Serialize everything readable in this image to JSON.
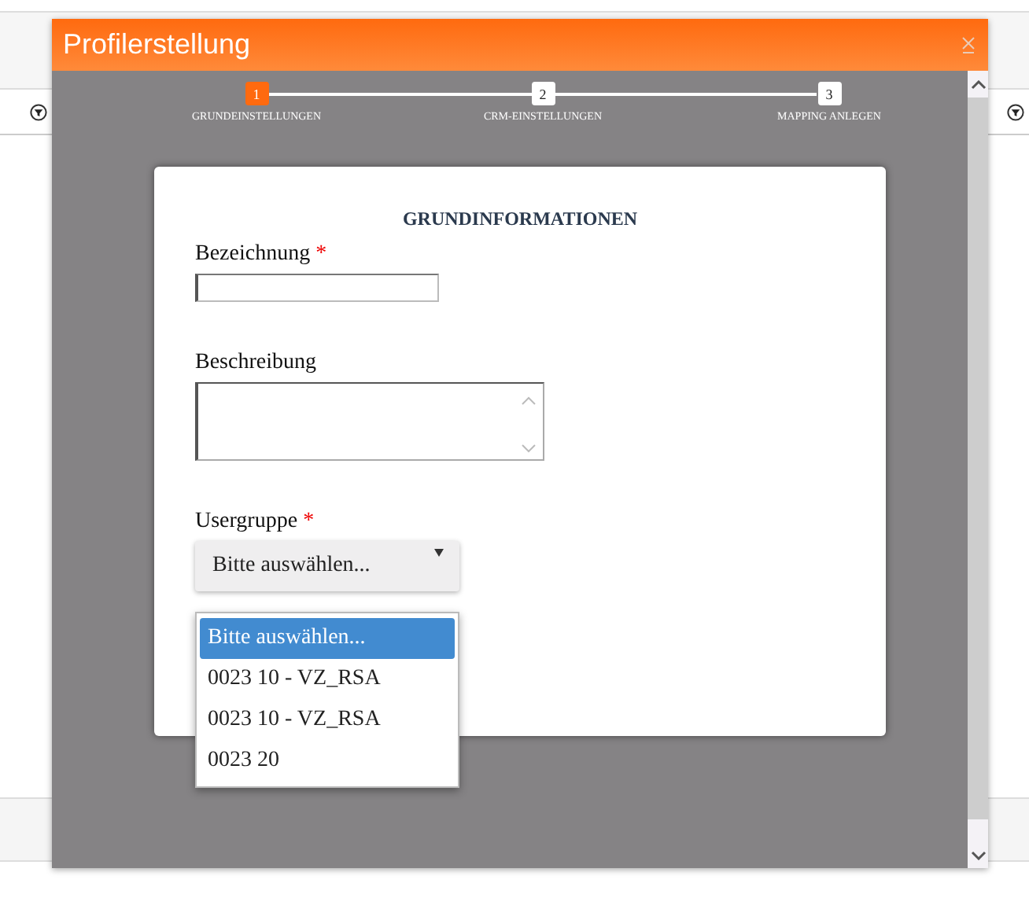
{
  "dialog": {
    "title": "Profilerstellung",
    "steps": [
      {
        "number": "1",
        "label": "GRUNDEINSTELLUNGEN",
        "selected": true
      },
      {
        "number": "2",
        "label": "CRM-EINSTELLUNGEN",
        "selected": false
      },
      {
        "number": "3",
        "label": "MAPPING ANLEGEN",
        "selected": false
      }
    ],
    "section_title": "GRUNDINFORMATIONEN",
    "fields": [
      {
        "kind": "text",
        "label": "Bezeichnung",
        "required_mark": "*"
      },
      {
        "kind": "textarea",
        "label": "Beschreibung"
      },
      {
        "kind": "select",
        "label": "Usergruppe",
        "required_mark": "*",
        "value": "Bitte auswählen...",
        "expanded": true,
        "options": [
          {
            "label": "Bitte auswählen...",
            "selected": true
          },
          {
            "label": "0023 10 - VZ_RSA",
            "selected": false
          },
          {
            "label": "0023 10 - VZ_RSA",
            "selected": false
          },
          {
            "label": "0023 20",
            "selected": false
          }
        ]
      }
    ]
  }
}
